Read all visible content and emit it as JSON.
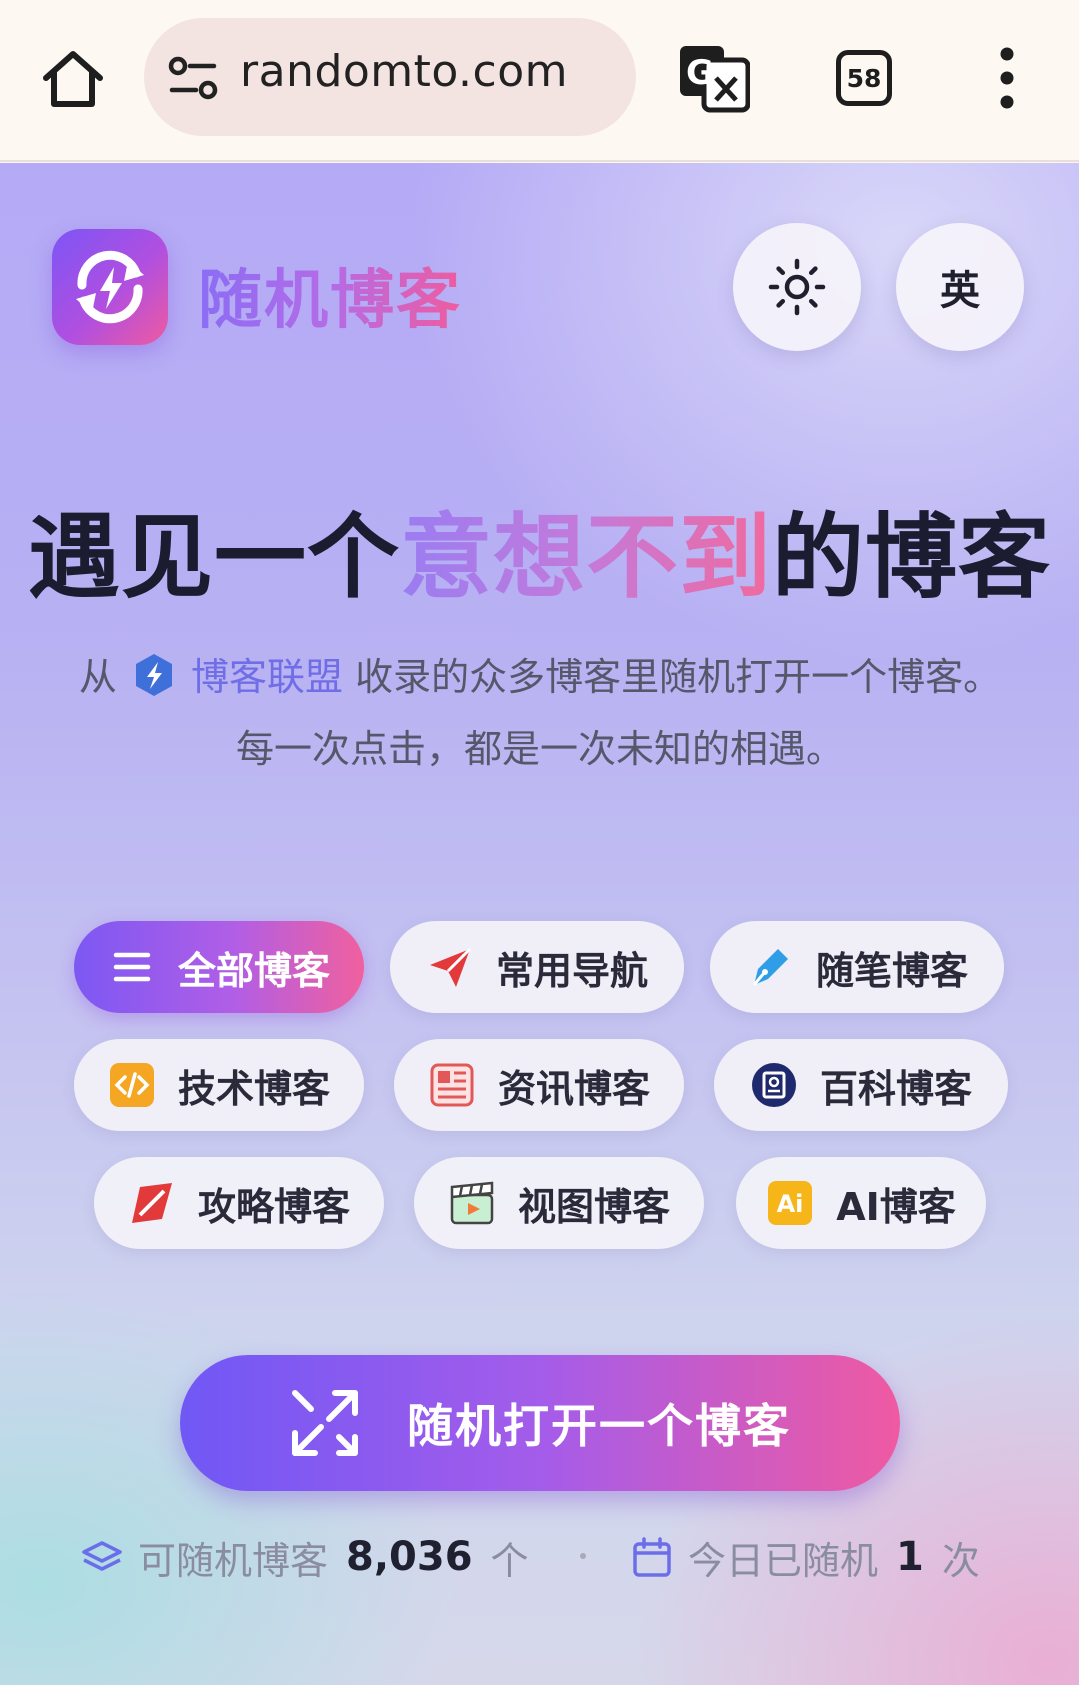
{
  "browser": {
    "url": "randomto.com",
    "tab_count": "58"
  },
  "header": {
    "site_name": "随机博客",
    "lang_label": "英"
  },
  "hero": {
    "headline_pre": "遇见一个",
    "headline_highlight": "意想不到",
    "headline_post": "的博客",
    "desc_from": "从",
    "desc_alliance": "博客联盟",
    "desc_rest": "收录的众多博客里随机打开一个博客。",
    "desc_line2": "每一次点击，都是一次未知的相遇。"
  },
  "categories": [
    {
      "label": "全部博客",
      "icon": "menu-icon",
      "active": true
    },
    {
      "label": "常用导航",
      "icon": "paper-plane-icon",
      "active": false
    },
    {
      "label": "随笔博客",
      "icon": "pen-icon",
      "active": false
    },
    {
      "label": "技术博客",
      "icon": "code-icon",
      "active": false
    },
    {
      "label": "资讯博客",
      "icon": "newspaper-icon",
      "active": false
    },
    {
      "label": "百科博客",
      "icon": "encyclopedia-icon",
      "active": false
    },
    {
      "label": "攻略博客",
      "icon": "guide-icon",
      "active": false
    },
    {
      "label": "视图博客",
      "icon": "video-clapper-icon",
      "active": false
    },
    {
      "label": "AI博客",
      "icon": "ai-icon",
      "active": false
    }
  ],
  "main_button": {
    "label": "随机打开一个博客",
    "icon": "shuffle-icon"
  },
  "stats": {
    "available_label": "可随机博客",
    "available_count": "8,036",
    "available_unit": "个",
    "today_label": "今日已随机",
    "today_count": "1",
    "today_unit": "次"
  },
  "colors": {
    "brand_start": "#7c58f3",
    "brand_end": "#f0609e",
    "headline": "#1c1c30"
  }
}
